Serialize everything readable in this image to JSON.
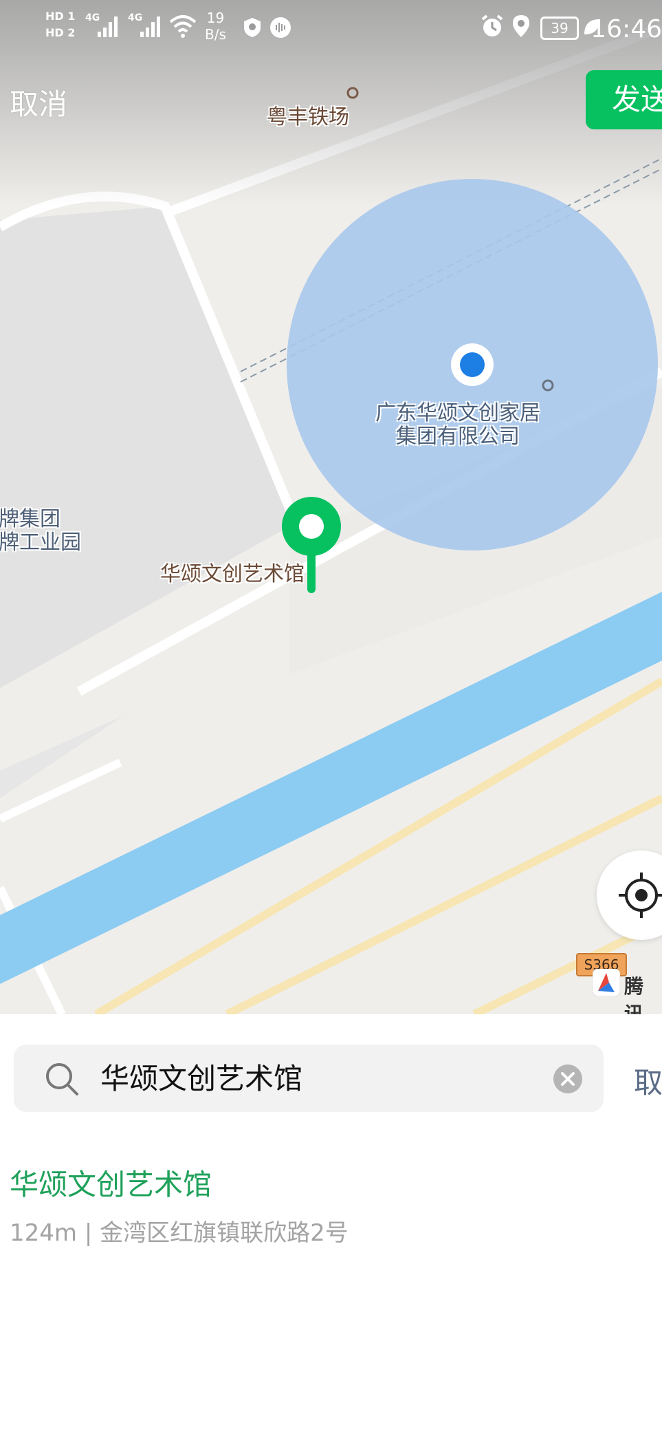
{
  "status_bar": {
    "hd1": "HD 1",
    "hd2": "HD 2",
    "net1": "4G",
    "net2": "4G",
    "speed_value": "19",
    "speed_unit": "B/s",
    "battery": "39",
    "time": "16:46"
  },
  "header": {
    "cancel_label": "取消",
    "send_label": "发送"
  },
  "map": {
    "labels": {
      "poi_top": "粤丰铁场",
      "company_line1": "广东华颂文创家居",
      "company_line2": "集团有限公司",
      "park_line1": "牌集团",
      "park_line2": "牌工业园",
      "selected_poi": "华颂文创艺术馆"
    },
    "road_shield": "S366",
    "attribution": "腾讯",
    "colors": {
      "accuracy_circle": "#a9c8ec",
      "user_dot": "#1d7ee4",
      "pin": "#07c160",
      "river": "#8ccbf2"
    }
  },
  "search": {
    "query": "华颂文创艺术馆",
    "cancel_label": "取"
  },
  "results": [
    {
      "title": "华颂文创艺术馆",
      "subtitle": "124m | 金湾区红旗镇联欣路2号"
    }
  ]
}
